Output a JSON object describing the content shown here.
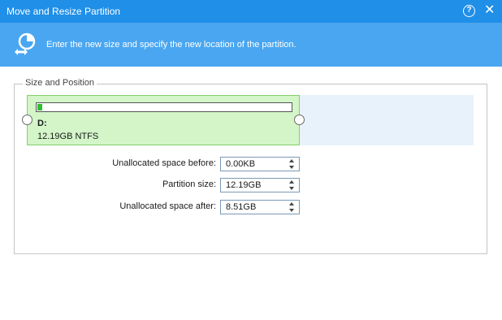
{
  "window": {
    "title": "Move and Resize Partition",
    "help_glyph": "?",
    "close_glyph": "✕"
  },
  "banner": {
    "message": "Enter the new size and specify the new location of the partition.",
    "bg_color": "#4aa6f0"
  },
  "group": {
    "legend": "Size and Position"
  },
  "partition": {
    "name": "D:",
    "info": "12.19GB NTFS",
    "used_fraction": 0.02,
    "color": "#d3f5c8"
  },
  "fields": [
    {
      "label": "Unallocated space before:",
      "value": "0.00KB"
    },
    {
      "label": "Partition size:",
      "value": "12.19GB"
    },
    {
      "label": "Unallocated space after:",
      "value": "8.51GB"
    }
  ],
  "colors": {
    "titlebar": "#1f8fe8",
    "track": "#e8f2fb"
  }
}
